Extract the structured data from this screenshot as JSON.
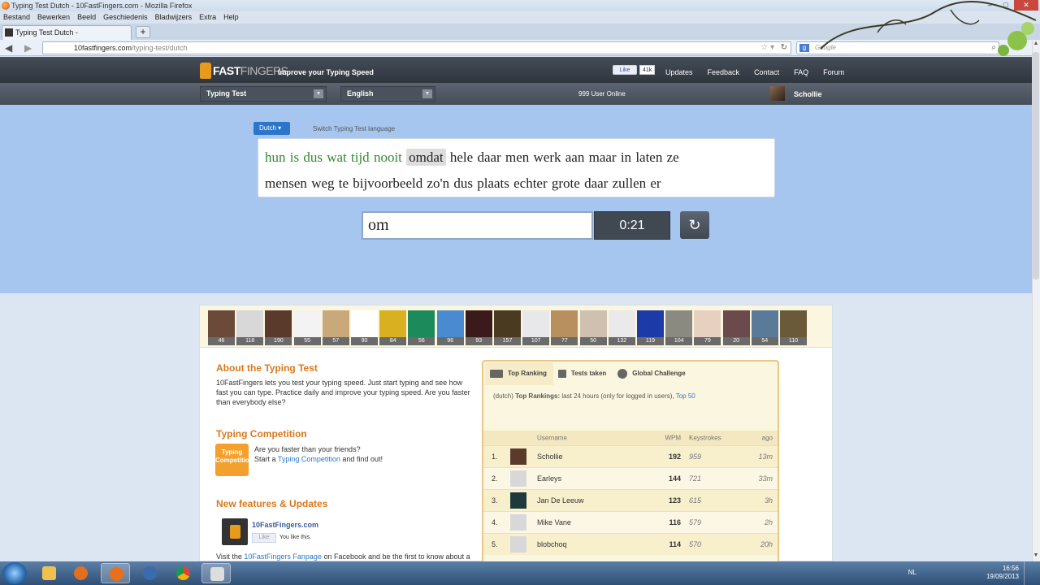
{
  "window": {
    "title": "Typing Test Dutch - 10FastFingers.com - Mozilla Firefox",
    "controls": [
      "–",
      "□",
      "✕"
    ]
  },
  "menubar": [
    "Bestand",
    "Bewerken",
    "Beeld",
    "Geschiedenis",
    "Bladwijzers",
    "Extra",
    "Help"
  ],
  "tab": {
    "title": "Typing Test Dutch - 10FastFingers.com",
    "new_tab": "+"
  },
  "urlbar": {
    "domain": "10fastfingers.com",
    "path": "/typing-test/dutch"
  },
  "searchbar": {
    "engine": "g",
    "placeholder": "Google"
  },
  "site": {
    "logo_ten": "10",
    "logo_fast": "FAST",
    "logo_fingers": "FINGERS",
    "tagline": "Improve your Typing Speed",
    "like_label": "Like",
    "like_count": "41k",
    "nav": [
      "Updates",
      "Feedback",
      "Contact",
      "FAQ",
      "Forum"
    ],
    "test_type": "Typing Test",
    "ui_language": "English",
    "users_online": "999 User Online",
    "username": "Schollie"
  },
  "test": {
    "language_button": "Dutch ▾",
    "switch_label": "Switch Typing Test language",
    "words_line1": {
      "done": [
        "hun",
        "is",
        "dus",
        "wat",
        "tijd",
        "nooit"
      ],
      "current": "omdat",
      "rest": [
        "hele",
        "daar",
        "men",
        "werk",
        "aan",
        "maar",
        "in",
        "laten",
        "ze"
      ]
    },
    "words_line2": [
      "mensen",
      "weg",
      "te",
      "bijvoorbeeld",
      "zo'n",
      "dus",
      "plaats",
      "echter",
      "grote",
      "daar",
      "zullen",
      "er"
    ],
    "input_value": "om",
    "timer": "0:21",
    "reload_icon": "↻"
  },
  "avatars": [
    {
      "count": "46",
      "color": "#6b4a3a"
    },
    {
      "count": "118",
      "color": "#d8d8d8"
    },
    {
      "count": "190",
      "color": "#5a3a2a"
    },
    {
      "count": "55",
      "color": "#f3f3f3"
    },
    {
      "count": "57",
      "color": "#c9a87a"
    },
    {
      "count": "90",
      "color": "#ffffff"
    },
    {
      "count": "84",
      "color": "#d8b020"
    },
    {
      "count": "56",
      "color": "#1c8a5a"
    },
    {
      "count": "96",
      "color": "#4a8ad0"
    },
    {
      "count": "93",
      "color": "#3a1a1a"
    },
    {
      "count": "157",
      "color": "#4a3a20"
    },
    {
      "count": "107",
      "color": "#e8e8ea"
    },
    {
      "count": "77",
      "color": "#b89060"
    },
    {
      "count": "50",
      "color": "#d0c0b0"
    },
    {
      "count": "132",
      "color": "#eaeaea"
    },
    {
      "count": "119",
      "color": "#1c3aa8"
    },
    {
      "count": "104",
      "color": "#8a8a80"
    },
    {
      "count": "79",
      "color": "#e8d0c0"
    },
    {
      "count": "20",
      "color": "#6a4a4a"
    },
    {
      "count": "54",
      "color": "#5a7a9a"
    },
    {
      "count": "110",
      "color": "#6a5a3a"
    }
  ],
  "about": {
    "title": "About the Typing Test",
    "text": "10FastFingers lets you test your typing speed. Just start typing and see how fast you can type. Practice daily and improve your typing speed. Are you faster than everybody else?"
  },
  "competition": {
    "title": "Typing Competition",
    "icon_label": "Typing Competition",
    "line1": "Are you faster than your friends?",
    "line2_pre": "Start a",
    "line2_link": "Typing Competition",
    "line2_post": "and find out!"
  },
  "updates": {
    "title": "New features & Updates",
    "fb_name": "10FastFingers.com",
    "fb_like": "Like",
    "fb_you_like": "You like this.",
    "fanpage_pre": "Visit the",
    "fanpage_link": "10FastFingers Fanpage",
    "fanpage_post": "on Facebook and be the first to know about a"
  },
  "ranking": {
    "tabs": [
      "Top Ranking",
      "Tests taken",
      "Global Challenge"
    ],
    "desc_prefix": "(dutch)",
    "desc_bold": "Top Rankings:",
    "desc_text": "last 24 hours (only for logged in users),",
    "desc_link": "Top 50",
    "headers": {
      "username": "Username",
      "wpm": "WPM",
      "keystrokes": "Keystrokes",
      "ago": "ago"
    },
    "rows": [
      {
        "num": "1.",
        "name": "Schollie",
        "wpm": "192",
        "ks": "959",
        "ago": "13m",
        "avatar": "#5a3a2a"
      },
      {
        "num": "2.",
        "name": "Earleys",
        "wpm": "144",
        "ks": "721",
        "ago": "33m",
        "avatar": "#d8d8d8"
      },
      {
        "num": "3.",
        "name": "Jan De Leeuw",
        "wpm": "123",
        "ks": "615",
        "ago": "3h",
        "avatar": "#1e3a3a"
      },
      {
        "num": "4.",
        "name": "Mike Vane",
        "wpm": "116",
        "ks": "579",
        "ago": "2h",
        "avatar": "#d8d8d8"
      },
      {
        "num": "5.",
        "name": "blobchoq",
        "wpm": "114",
        "ks": "570",
        "ago": "20h",
        "avatar": "#d8d8d8"
      }
    ]
  },
  "taskbar": {
    "items": [
      "explorer",
      "media-player",
      "firefox",
      "thunderbird",
      "chrome",
      "app"
    ],
    "lang": "NL",
    "time": "16:56",
    "date": "19/09/2013"
  }
}
